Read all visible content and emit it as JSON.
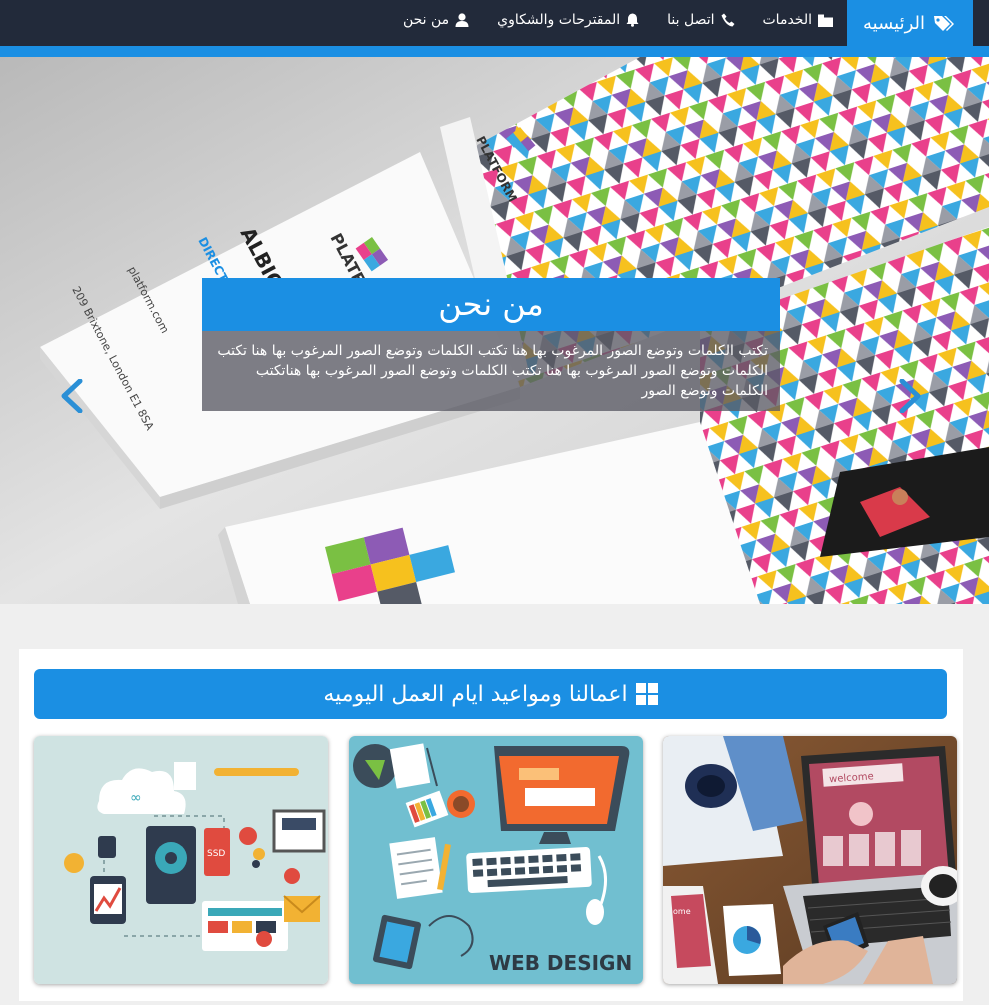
{
  "nav": {
    "brand": "الرئيسيه",
    "items": [
      {
        "label": "الخدمات",
        "icon": "folder-icon"
      },
      {
        "label": "اتصل بنا",
        "icon": "phone-icon"
      },
      {
        "label": "المقترحات والشكاوي",
        "icon": "bell-icon"
      },
      {
        "label": "من نحن",
        "icon": "user-icon"
      }
    ],
    "brand_icon": "tags-icon"
  },
  "hero": {
    "title": "من نحن",
    "text": "تكتب الكلمات وتوضع الصور المرغوب بها هنا تكتب الكلمات وتوضع الصور المرغوب بها هنا تكتب الكلمات وتوضع الصور المرغوب بها هنا تكتب الكلمات وتوضع الصور المرغوب بها هناتكتب الكلمات وتوضع الصور",
    "card_brand": "PLATFORM",
    "card_name": "ALBION",
    "card_role": "DIRECTO",
    "card_address": "209 Brixtone, London E1 8SA",
    "card_web": "platform.com"
  },
  "section": {
    "title": "اعمالنا ومواعيد ايام العمل اليوميه",
    "title_icon": "windows-grid-icon",
    "cards": [
      {
        "name": "tech-illustration",
        "tag": "SSD"
      },
      {
        "name": "web-design-illustration",
        "tag": "WEB DESIGN"
      },
      {
        "name": "laptop-photo",
        "tag": "welcome"
      }
    ]
  },
  "colors": {
    "nav_bg": "#222a3a",
    "accent": "#1b8fe3",
    "page_bg": "#efefef"
  }
}
